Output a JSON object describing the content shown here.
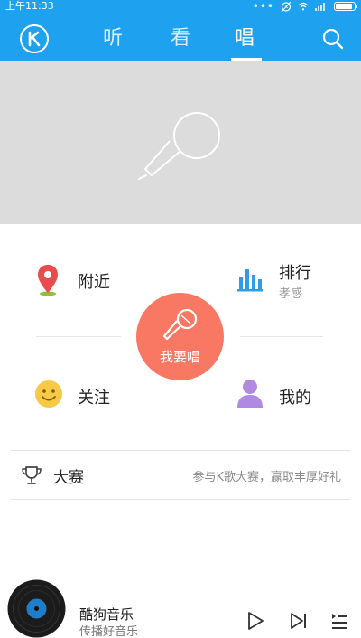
{
  "status_bar": {
    "time": "上午11:33",
    "battery_level": 0.9
  },
  "header": {
    "tabs": [
      {
        "label": "听",
        "active": false
      },
      {
        "label": "看",
        "active": false
      },
      {
        "label": "唱",
        "active": true
      }
    ],
    "icons": {
      "logo": "k-logo-icon",
      "search": "search-icon"
    }
  },
  "banner": {
    "icon": "microphone-icon"
  },
  "actions": {
    "nearby": {
      "label": "附近",
      "icon": "location-pin-icon"
    },
    "ranking": {
      "label": "排行",
      "sub": "孝感",
      "icon": "bar-chart-icon"
    },
    "follow": {
      "label": "关注",
      "icon": "smiley-icon"
    },
    "mine": {
      "label": "我的",
      "icon": "person-icon"
    },
    "sing": {
      "label": "我要唱",
      "icon": "microphone-icon"
    }
  },
  "contest": {
    "title": "大赛",
    "desc": "参与K歌大赛，赢取丰厚好礼",
    "icon": "trophy-icon"
  },
  "player": {
    "song": "酷狗音乐",
    "artist": "传播好音乐",
    "controls": [
      "play-icon",
      "next-icon",
      "playlist-icon"
    ]
  },
  "colors": {
    "header_bg": "#1ea2f0",
    "sing_button": "#f87864",
    "banner_bg": "#dcdcdc",
    "pin": "#e84c4c",
    "chart": "#2f9de5",
    "smiley": "#f7c945",
    "person": "#b08ae0"
  }
}
